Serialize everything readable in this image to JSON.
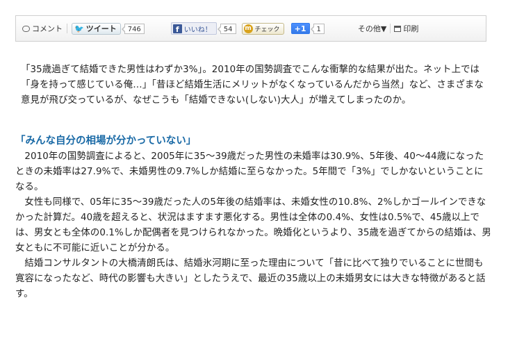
{
  "toolbar": {
    "comment_label": "コメント",
    "tweet_label": "ツイート",
    "tweet_count": "746",
    "like_label": "いいね！",
    "like_count": "54",
    "check_label": "チェック",
    "plusone_label": "+1",
    "plusone_count": "1",
    "others_label": "その他▼",
    "print_label": "印刷"
  },
  "article": {
    "lead": "「35歳過ぎて結婚できた男性はわずか3%」。2010年の国勢調査でこんな衝撃的な結果が出た。ネット上では「身を持って感じている俺…」「昔ほど結婚生活にメリットがなくなっているんだから当然」など、さまざまな意見が飛び交っているが、なぜこうも「結婚できない(しない)大人」が増えてしまったのか。",
    "heading": "「みんな自分の相場が分かっていない」",
    "paragraphs": [
      "2010年の国勢調査によると、2005年に35～39歳だった男性の未婚率は30.9%、5年後、40～44歳になったときの未婚率は27.9%で、未婚男性の9.7%しか結婚に至らなかった。5年間で「3%」でしかないということになる。",
      "女性も同様で、05年に35～39歳だった人の5年後の結婚率は、未婚女性の10.8%、2%しかゴールインできなかった計算だ。40歳を超えると、状況はますます悪化する。男性は全体の0.4%、女性は0.5%で、45歳以上では、男女とも全体の0.1%しか配偶者を見つけられなかった。晩婚化というより、35歳を過ぎてからの結婚は、男女ともに不可能に近いことが分かる。",
      "結婚コンサルタントの大橋清朗氏は、結婚氷河期に至った理由について「昔に比べて独りでいることに世間も寛容になったなど、時代の影響も大きい」としたうえで、最近の35歳以上の未婚男女には大きな特徴があると話す。"
    ]
  },
  "colors": {
    "heading": "#1a6aa6",
    "twitter": "#2fa9df",
    "facebook": "#3b5998",
    "google": "#4d90fe"
  },
  "icons": [
    "comment-icon",
    "twitter-bird-icon",
    "facebook-icon",
    "mixi-icon",
    "print-icon"
  ]
}
